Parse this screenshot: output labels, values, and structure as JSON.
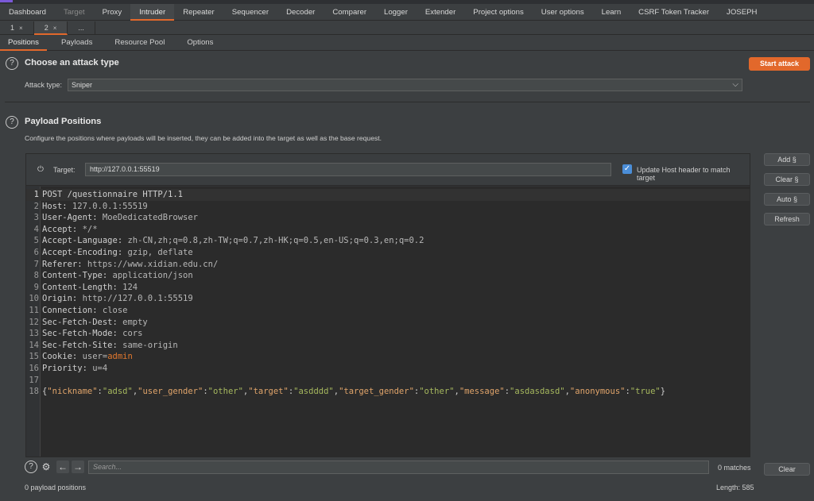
{
  "main_tabs": [
    {
      "label": "Dashboard",
      "dim": false
    },
    {
      "label": "Target",
      "dim": true
    },
    {
      "label": "Proxy",
      "dim": false
    },
    {
      "label": "Intruder",
      "dim": false,
      "active": true
    },
    {
      "label": "Repeater",
      "dim": false
    },
    {
      "label": "Sequencer",
      "dim": false
    },
    {
      "label": "Decoder",
      "dim": false
    },
    {
      "label": "Comparer",
      "dim": false
    },
    {
      "label": "Logger",
      "dim": false
    },
    {
      "label": "Extender",
      "dim": false
    },
    {
      "label": "Project options",
      "dim": false
    },
    {
      "label": "User options",
      "dim": false
    },
    {
      "label": "Learn",
      "dim": false
    },
    {
      "label": "CSRF Token Tracker",
      "dim": false
    },
    {
      "label": "JOSEPH",
      "dim": false
    }
  ],
  "sub_tabs": [
    {
      "label": "1",
      "close": "×"
    },
    {
      "label": "2",
      "close": "×",
      "active": true
    },
    {
      "label": "...",
      "close": ""
    }
  ],
  "section_tabs": [
    "Positions",
    "Payloads",
    "Resource Pool",
    "Options"
  ],
  "attack": {
    "title": "Choose an attack type",
    "type_label": "Attack type:",
    "type_value": "Sniper",
    "start_button": "Start attack"
  },
  "positions": {
    "title": "Payload Positions",
    "description": "Configure the positions where payloads will be inserted, they can be added into the target as well as the base request.",
    "target_label": "Target:",
    "target_value": "http://127.0.0.1:55519",
    "update_host_label": "Update Host header to match target",
    "update_host_checked": true
  },
  "side_buttons": [
    "Add §",
    "Clear §",
    "Auto §",
    "Refresh"
  ],
  "request_lines": [
    {
      "n": "1",
      "name": "POST /questionnaire HTTP/1.1",
      "value": ""
    },
    {
      "n": "2",
      "name": "Host:",
      "value": " 127.0.0.1:55519"
    },
    {
      "n": "3",
      "name": "User-Agent:",
      "value": " MoeDedicatedBrowser"
    },
    {
      "n": "4",
      "name": "Accept:",
      "value": " */*"
    },
    {
      "n": "5",
      "name": "Accept-Language:",
      "value": " zh-CN,zh;q=0.8,zh-TW;q=0.7,zh-HK;q=0.5,en-US;q=0.3,en;q=0.2"
    },
    {
      "n": "6",
      "name": "Accept-Encoding:",
      "value": " gzip, deflate"
    },
    {
      "n": "7",
      "name": "Referer:",
      "value": " https://www.xidian.edu.cn/"
    },
    {
      "n": "8",
      "name": "Content-Type:",
      "value": " application/json"
    },
    {
      "n": "9",
      "name": "Content-Length:",
      "value": " 124"
    },
    {
      "n": "10",
      "name": "Origin:",
      "value": " http://127.0.0.1:55519"
    },
    {
      "n": "11",
      "name": "Connection:",
      "value": " close"
    },
    {
      "n": "12",
      "name": "Sec-Fetch-Dest:",
      "value": " empty"
    },
    {
      "n": "13",
      "name": "Sec-Fetch-Mode:",
      "value": " cors"
    },
    {
      "n": "14",
      "name": "Sec-Fetch-Site:",
      "value": " same-origin"
    },
    {
      "n": "15",
      "name": "Cookie:",
      "value": " user=",
      "cookie_value": "admin"
    },
    {
      "n": "16",
      "name": "Priority:",
      "value": " u=4"
    },
    {
      "n": "17",
      "name": "",
      "value": ""
    }
  ],
  "json_line": {
    "n": "18",
    "pairs": [
      {
        "k": "\"nickname\"",
        "v": "\"adsd\""
      },
      {
        "k": "\"user_gender\"",
        "v": "\"other\""
      },
      {
        "k": "\"target\"",
        "v": "\"asdddd\""
      },
      {
        "k": "\"target_gender\"",
        "v": "\"other\""
      },
      {
        "k": "\"message\"",
        "v": "\"asdasdasd\""
      },
      {
        "k": "\"anonymous\"",
        "v": "\"true\""
      }
    ]
  },
  "bottom": {
    "search_placeholder": "Search...",
    "matches": "0 matches",
    "clear_button": "Clear",
    "payload_positions": "0 payload positions",
    "length": "Length: 585"
  },
  "colors": {
    "accent": "#e2682b",
    "checkbox": "#4b8ed8"
  }
}
